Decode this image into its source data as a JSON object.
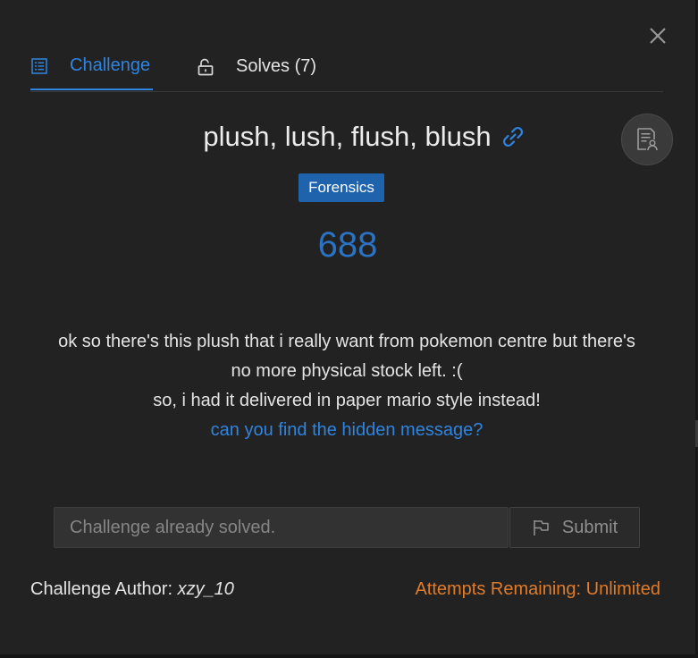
{
  "modal": {
    "close_icon": "close-icon"
  },
  "tabs": [
    {
      "label": "Challenge",
      "icon": "list-icon",
      "active": true
    },
    {
      "label": "Solves (7)",
      "icon": "lock-open-icon",
      "active": false
    }
  ],
  "challenge": {
    "title": "plush, lush, flush, blush",
    "category": "Forensics",
    "points": "688",
    "description": {
      "line1": "ok so there's this plush that i really want from pokemon centre but there's",
      "line2": "no more physical stock left. :(",
      "line3": "so, i had it delivered in paper mario style instead!",
      "hint": "can you find the hidden message?"
    }
  },
  "answer": {
    "placeholder": "Challenge already solved.",
    "submit_label": "Submit"
  },
  "footer": {
    "author_label": "Challenge Author: ",
    "author_name": "xzy_10",
    "attempts": "Attempts Remaining: Unlimited"
  },
  "colors": {
    "accent": "#2f84e0",
    "badge": "#1f63ad",
    "points": "#2a72c4",
    "attempts": "#e07b2a",
    "background": "#222222"
  }
}
